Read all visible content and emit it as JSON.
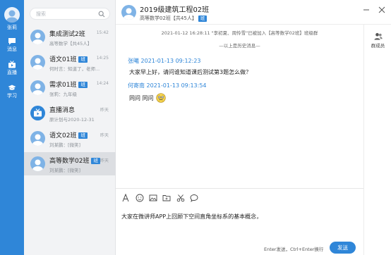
{
  "rail": {
    "user_name": "张莉",
    "items": [
      {
        "label": "消息",
        "icon": "message-icon"
      },
      {
        "label": "直播",
        "icon": "live-icon"
      },
      {
        "label": "学习",
        "icon": "study-icon"
      }
    ]
  },
  "search": {
    "placeholder": "搜索"
  },
  "conversations": [
    {
      "name": "集成测试2班",
      "badge": "",
      "time": "15:42",
      "preview": "高等数学【共45人】"
    },
    {
      "name": "语文01班",
      "badge": "班",
      "time": "14:25",
      "preview": "何时言：知道了，老师..."
    },
    {
      "name": "需求01班",
      "badge": "班",
      "time": "14:24",
      "preview": "张莉：九年级"
    },
    {
      "name": "直播消息",
      "badge": "",
      "time": "昨天",
      "preview": "原计划与2020-12-31"
    },
    {
      "name": "语文02班",
      "badge": "班",
      "time": "昨天",
      "preview": "刘某鹏：[微笑]"
    },
    {
      "name": "高等数学02班",
      "badge": "班",
      "time": "昨天",
      "preview": "刘某鹏：[微笑]"
    }
  ],
  "header": {
    "title": "2019级建筑工程02班",
    "subtitle": "高等数学02班【共45人】",
    "badge": "班"
  },
  "members": {
    "label": "群成员"
  },
  "chat": {
    "system_join": "2021-01-12 16:28:11 \"李初夏、周怜雪\"已被加入【高等数学02班】班级群",
    "system_history": "—以上是历史消息—",
    "messages": [
      {
        "sender_time": "张曦 2021-01-13 09:12:23",
        "text": "大家早上好，请问谁知道课后测试第3题怎么做？"
      },
      {
        "sender_time": "何寄南 2021-01-13 09:13:54",
        "text": "同问 同问"
      }
    ]
  },
  "toolbar": {
    "tools": [
      "font-icon",
      "emoji-icon",
      "image-icon",
      "folder-icon",
      "scissors-icon",
      "chat-bubble-icon"
    ]
  },
  "input": {
    "text": "大家在微讲师APP上回顾下空间直角坐标系的基本概念，"
  },
  "footer": {
    "hint": "Enter发送，Ctrl+Enter换行",
    "send_label": "发送"
  },
  "colors": {
    "accent": "#2f86d8",
    "list_bg": "#f2f3f5",
    "active_bg": "#dcdee2"
  }
}
